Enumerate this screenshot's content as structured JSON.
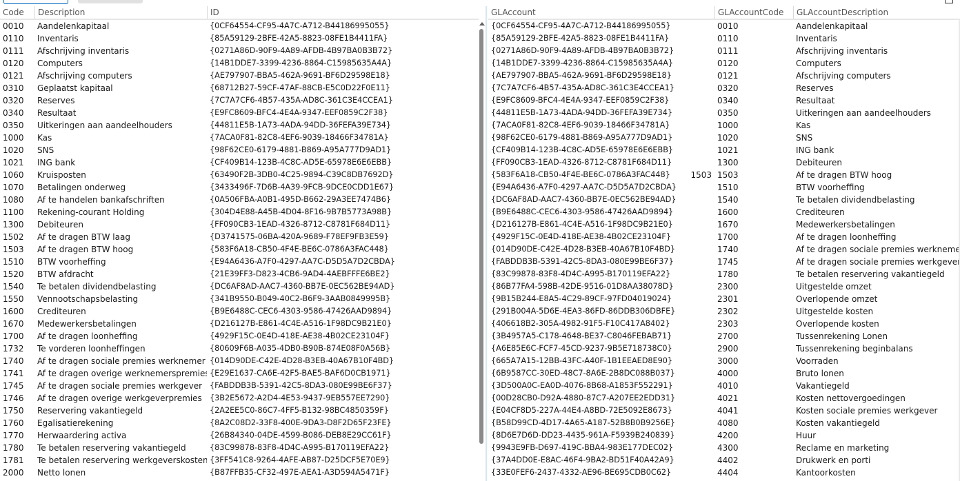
{
  "left_grid": {
    "columns": [
      "Code",
      "Description",
      "ID"
    ],
    "rows": [
      [
        "0010",
        "Aandelenkapitaal",
        "{0CF64554-CF95-4A7C-A712-B44186995055}"
      ],
      [
        "0110",
        "Inventaris",
        "{85A59129-2BFE-42A5-8823-08FE1B4411FA}"
      ],
      [
        "0111",
        "Afschrijving inventaris",
        "{0271A86D-90F9-4A89-AFDB-4B97BA0B3B72}"
      ],
      [
        "0120",
        "Computers",
        "{14B1DDE7-3399-4236-8864-C15985635A4A}"
      ],
      [
        "0121",
        "Afschrijving computers",
        "{AE797907-BBA5-462A-9691-BF6D29598E18}"
      ],
      [
        "0310",
        "Geplaatst kapitaal",
        "{68712B27-59CF-47AF-88CB-E5C0D22F0E11}"
      ],
      [
        "0320",
        "Reserves",
        "{7C7A7CF6-4B57-435A-AD8C-361C3E4CCEA1}"
      ],
      [
        "0340",
        "Resultaat",
        "{E9FC8609-BFC4-4E4A-9347-EEF0859C2F38}"
      ],
      [
        "0350",
        "Uitkeringen aan aandeelhouders",
        "{44811E5B-1A73-4ADA-94DD-36FEFA39E734}"
      ],
      [
        "1000",
        "Kas",
        "{7ACA0F81-82C8-4EF6-9039-18466F34781A}"
      ],
      [
        "1020",
        "SNS",
        "{98F62CE0-6179-4881-B869-A95A777D9AD1}"
      ],
      [
        "1021",
        "ING bank",
        "{CF409B14-123B-4C8C-AD5E-65978E6E6EBB}"
      ],
      [
        "1060",
        "Kruisposten",
        "{63490F2B-3DB0-4C25-9894-C39C8DB7692D}"
      ],
      [
        "1070",
        "Betalingen onderweg",
        "{3433496F-7D6B-4A39-9FCB-9DCE0CDD1E67}"
      ],
      [
        "1080",
        "Af te handelen bankafschriften",
        "{0A506FBA-A0B1-495D-B662-29A3EE7474B6}"
      ],
      [
        "1100",
        "Rekening-courant Holding",
        "{304D4E88-A45B-4D04-8F16-9B7B5773A98B}"
      ],
      [
        "1300",
        "Debiteuren",
        "{FF090CB3-1EAD-4326-8712-C8781F684D11}"
      ],
      [
        "1502",
        "Af te dragen BTW laag",
        "{D3741575-06BA-420A-9689-F78EF9FB3E59}"
      ],
      [
        "1503",
        "Af te dragen BTW hoog",
        "{583F6A18-CB50-4F4E-BE6C-0786A3FAC448}"
      ],
      [
        "1510",
        "BTW voorheffing",
        "{E94A6436-A7F0-4297-AA7C-D5D5A7D2CBDA}"
      ],
      [
        "1520",
        "BTW afdracht",
        "{21E39FF3-D823-4CB6-9AD4-4AEBFFFE6BE2}"
      ],
      [
        "1540",
        "Te betalen dividendbelasting",
        "{DC6AF8AD-AAC7-4360-BB7E-0EC562BE94AD}"
      ],
      [
        "1550",
        "Vennootschapsbelasting",
        "{341B9550-B049-40C2-B6F9-3AAB0849995B}"
      ],
      [
        "1600",
        "Crediteuren",
        "{B9E6488C-CEC6-4303-9586-47426AAD9894}"
      ],
      [
        "1670",
        "Medewerkersbetalingen",
        "{D216127B-E861-4C4E-A516-1F98DC9B21E0}"
      ],
      [
        "1700",
        "Af te dragen loonheffing",
        "{4929F15C-0E4D-418E-AE38-4B02CE23104F}"
      ],
      [
        "1732",
        "Te vorderen loonheffingen",
        "{80609F6B-A035-4DB0-B90B-874E08F0A56B}"
      ],
      [
        "1740",
        "Af te dragen sociale premies werknemer",
        "{014D90DE-C42E-4D28-B3EB-40A67B10F4BD}"
      ],
      [
        "1741",
        "Af te dragen overige werknemerspremies",
        "{E29E1637-CA6E-42F5-BAE5-BAF6D0CB1971}"
      ],
      [
        "1745",
        "Af te dragen sociale premies werkgever",
        "{FABDDB3B-5391-42C5-8DA3-080E99BE6F37}"
      ],
      [
        "1746",
        "Af te dragen overige werkgeverpremies",
        "{3B2E5672-A2D4-4E53-9437-9EB557EE7290}"
      ],
      [
        "1750",
        "Reservering vakantiegeld",
        "{2A2EE5C0-86C7-4FF5-B132-98BC4850359F}"
      ],
      [
        "1760",
        "Egalisatierekening",
        "{8A2C08D2-33F8-400E-9DA3-D8F2D65F23FE}"
      ],
      [
        "1770",
        "Herwaardering activa",
        "{26B84340-04DE-4599-B086-DEB8E29CC61F}"
      ],
      [
        "1780",
        "Te betalen reservering vakantiegeld",
        "{83C99878-83F8-4D4C-A995-B170119EFA22}"
      ],
      [
        "1781",
        "Te betalen reservering werkgeverskosten",
        "{3FF541C8-9264-4AFE-AB87-D25DCF5E70E9}"
      ],
      [
        "2000",
        "Netto lonen",
        "{B87FFB35-CF32-497E-AEA1-A3D594A5471F}"
      ]
    ]
  },
  "right_grid": {
    "columns": [
      "GLAccount",
      "",
      "GLAccountCode",
      "GLAccountDescription"
    ],
    "rows": [
      [
        "{0CF64554-CF95-4A7C-A712-B44186995055}",
        "",
        "0010",
        "Aandelenkapitaal"
      ],
      [
        "{85A59129-2BFE-42A5-8823-08FE1B4411FA}",
        "",
        "0110",
        "Inventaris"
      ],
      [
        "{0271A86D-90F9-4A89-AFDB-4B97BA0B3B72}",
        "",
        "0111",
        "Afschrijving inventaris"
      ],
      [
        "{14B1DDE7-3399-4236-8864-C15985635A4A}",
        "",
        "0120",
        "Computers"
      ],
      [
        "{AE797907-BBA5-462A-9691-BF6D29598E18}",
        "",
        "0121",
        "Afschrijving computers"
      ],
      [
        "{7C7A7CF6-4B57-435A-AD8C-361C3E4CCEA1}",
        "",
        "0320",
        "Reserves"
      ],
      [
        "{E9FC8609-BFC4-4E4A-9347-EEF0859C2F38}",
        "",
        "0340",
        "Resultaat"
      ],
      [
        "{44811E5B-1A73-4ADA-94DD-36FEFA39E734}",
        "",
        "0350",
        "Uitkeringen aan aandeelhouders"
      ],
      [
        "{7ACA0F81-82C8-4EF6-9039-18466F34781A}",
        "",
        "1000",
        "Kas"
      ],
      [
        "{98F62CE0-6179-4881-B869-A95A777D9AD1}",
        "",
        "1020",
        "SNS"
      ],
      [
        "{CF409B14-123B-4C8C-AD5E-65978E6E6EBB}",
        "",
        "1021",
        "ING bank"
      ],
      [
        "{FF090CB3-1EAD-4326-8712-C8781F684D11}",
        "",
        "1300",
        "Debiteuren"
      ],
      [
        "{583F6A18-CB50-4F4E-BE6C-0786A3FAC448}",
        "1503",
        "1503",
        "Af te dragen BTW hoog"
      ],
      [
        "{E94A6436-A7F0-4297-AA7C-D5D5A7D2CBDA}",
        "",
        "1510",
        "BTW voorheffing"
      ],
      [
        "{DC6AF8AD-AAC7-4360-BB7E-0EC562BE94AD}",
        "",
        "1540",
        "Te betalen dividendbelasting"
      ],
      [
        "{B9E6488C-CEC6-4303-9586-47426AAD9894}",
        "",
        "1600",
        "Crediteuren"
      ],
      [
        "{D216127B-E861-4C4E-A516-1F98DC9B21E0}",
        "",
        "1670",
        "Medewerkersbetalingen"
      ],
      [
        "{4929F15C-0E4D-418E-AE38-4B02CE23104F}",
        "",
        "1700",
        "Af te dragen loonheffing"
      ],
      [
        "{014D90DE-C42E-4D28-B3EB-40A67B10F4BD}",
        "",
        "1740",
        "Af te dragen sociale premies werknemer"
      ],
      [
        "{FABDDB3B-5391-42C5-8DA3-080E99BE6F37}",
        "",
        "1745",
        "Af te dragen sociale premies werkgever"
      ],
      [
        "{83C99878-83F8-4D4C-A995-B170119EFA22}",
        "",
        "1780",
        "Te betalen reservering vakantiegeld"
      ],
      [
        "{86B77FA4-598B-42DE-9516-01D8AA38078D}",
        "",
        "2300",
        "Uitgestelde omzet"
      ],
      [
        "{9B15B244-E8A5-4C29-89CF-97FD04019024}",
        "",
        "2301",
        "Overlopende omzet"
      ],
      [
        "{291B004A-5D6E-4EA3-86FD-86DDB306DBFE}",
        "",
        "2302",
        "Uitgestelde kosten"
      ],
      [
        "{406618B2-305A-4982-91F5-F10C417A8402}",
        "",
        "2303",
        "Overlopende kosten"
      ],
      [
        "{3B4957A5-C178-4648-BE37-C8046FEBAB71}",
        "",
        "2700",
        "Tussenrekening Lonen"
      ],
      [
        "{A6E85E6C-FCF7-45CD-9237-9B5E718738C0}",
        "",
        "2900",
        "Tussenrekening beginbalans"
      ],
      [
        "{665A7A15-12BB-43FC-A40F-1B1EEAED8E90}",
        "",
        "3000",
        "Voorraden"
      ],
      [
        "{6B9587CC-30ED-48C7-8A6E-2B8DC088B037}",
        "",
        "4000",
        "Bruto lonen"
      ],
      [
        "{3D500A0C-EA0D-4076-8B68-A1853F552291}",
        "",
        "4010",
        "Vakantiegeld"
      ],
      [
        "{00D28CB0-D92A-4880-87C7-A207EE2EDD31}",
        "",
        "4021",
        "Kosten nettovergoedingen"
      ],
      [
        "{E04CF8D5-227A-44E4-A8BD-72E5092E8673}",
        "",
        "4041",
        "Kosten sociale premies werkgever"
      ],
      [
        "{B58D99CD-4D17-4A65-A187-52B8B0B9256E}",
        "",
        "4080",
        "Kosten vakantiegeld"
      ],
      [
        "{8D6E7D6D-DD23-4435-961A-F5939B240839}",
        "",
        "4200",
        "Huur"
      ],
      [
        "{9943E9FB-D697-419C-BBA4-983E177DEC02}",
        "",
        "4300",
        "Reclame en marketing"
      ],
      [
        "{37A4DD0E-E8AC-46F4-9BA2-BD51F40A42A9}",
        "",
        "4402",
        "Drukwerk en porti"
      ],
      [
        "{33E0FEF6-2437-4332-AE96-BE695CDB0C62}",
        "",
        "4404",
        "Kantoorkosten"
      ]
    ]
  }
}
